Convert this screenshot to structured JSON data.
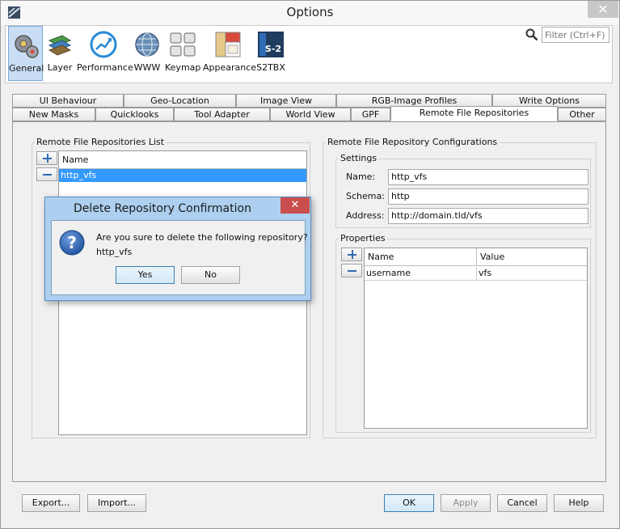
{
  "window": {
    "title": "Options",
    "close_glyph": "✕"
  },
  "toolbar": {
    "items": [
      {
        "label": "General",
        "icon": "gears-icon"
      },
      {
        "label": "Layer",
        "icon": "layers-icon"
      },
      {
        "label": "Performance",
        "icon": "gauge-icon"
      },
      {
        "label": "WWW",
        "icon": "globe-icon"
      },
      {
        "label": "Keymap",
        "icon": "keyboard-icon"
      },
      {
        "label": "Appearance",
        "icon": "palette-icon"
      },
      {
        "label": "S2TBX",
        "icon": "sentinel2-icon"
      }
    ],
    "search_placeholder": "Filter (Ctrl+F)"
  },
  "tabs": {
    "row1": [
      "UI Behaviour",
      "Geo-Location",
      "Image View",
      "RGB-Image Profiles",
      "Write Options"
    ],
    "row2": [
      "New Masks",
      "Quicklooks",
      "Tool Adapter",
      "World View",
      "GPF",
      "Remote File Repositories",
      "Other"
    ],
    "active": "Remote File Repositories"
  },
  "repos": {
    "group_title": "Remote File Repositories List",
    "column": "Name",
    "items": [
      "http_vfs"
    ]
  },
  "config": {
    "group_title": "Remote File Repository Configurations",
    "settings_title": "Settings",
    "name_label": "Name:",
    "name_value": "http_vfs",
    "schema_label": "Schema:",
    "schema_value": "http",
    "address_label": "Address:",
    "address_value": "http://domain.tld/vfs",
    "properties_title": "Properties",
    "col_name": "Name",
    "col_value": "Value",
    "rows": [
      {
        "name": "username",
        "value": "vfs"
      }
    ]
  },
  "buttons": {
    "export": "Export...",
    "import": "Import...",
    "ok": "OK",
    "apply": "Apply",
    "cancel": "Cancel",
    "help": "Help"
  },
  "dialog": {
    "title": "Delete Repository Confirmation",
    "message": "Are you sure to delete the following repository?",
    "repo": "http_vfs",
    "yes": "Yes",
    "no": "No"
  },
  "colors": {
    "selection": "#3399ff",
    "dialog_frame": "#aed0f0",
    "dialog_close": "#c94f4f",
    "accent_icon": "#2f6db5"
  }
}
